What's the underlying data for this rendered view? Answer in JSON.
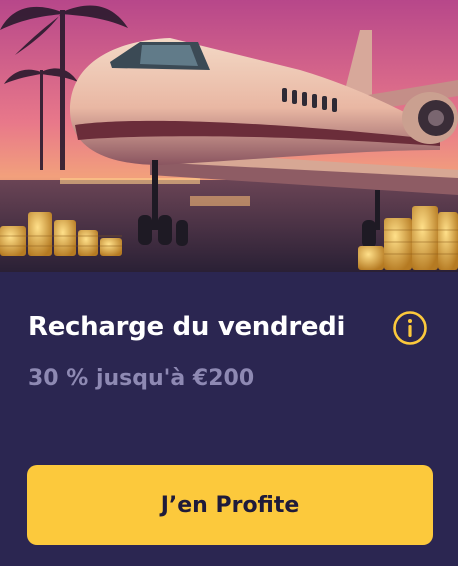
{
  "promo": {
    "title": "Recharge du vendredi",
    "subtitle": "30 % jusqu'à €200",
    "cta_label": "J’en Profite",
    "info_icon": "info-circle-icon",
    "hero_image": "private-jet-with-gold-coins"
  },
  "colors": {
    "card_background": "#2b2651",
    "title": "#ffffff",
    "subtitle": "#8e89b3",
    "accent": "#fcc93c",
    "cta_text": "#1f1b3a"
  }
}
